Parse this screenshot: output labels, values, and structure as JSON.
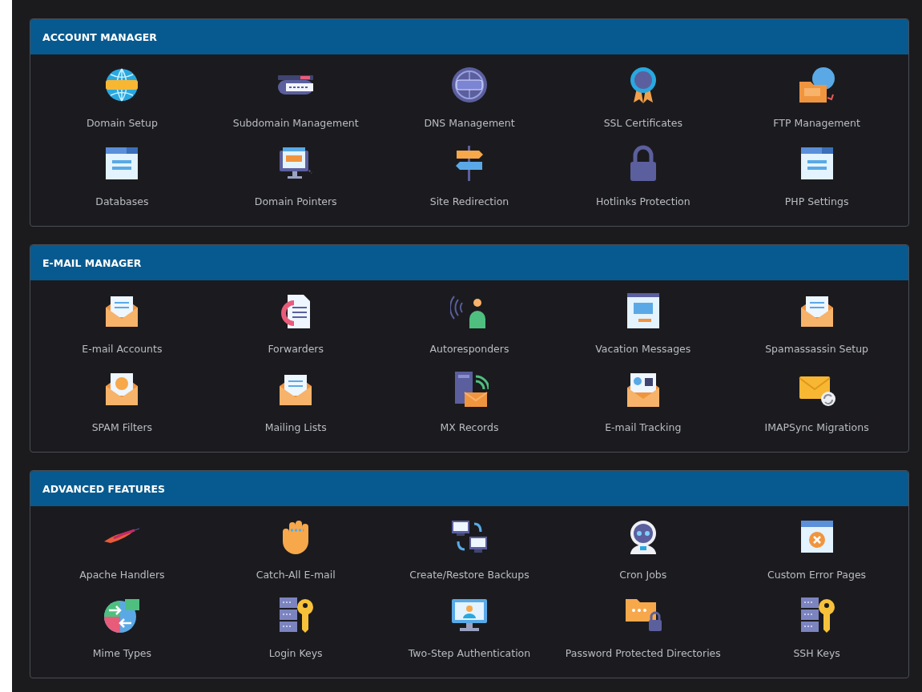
{
  "sections": [
    {
      "title": "ACCOUNT MANAGER",
      "items": [
        "Domain Setup",
        "Subdomain Management",
        "DNS Management",
        "SSL Certificates",
        "FTP Management",
        "Databases",
        "Domain Pointers",
        "Site Redirection",
        "Hotlinks Protection",
        "PHP Settings"
      ]
    },
    {
      "title": "E-MAIL MANAGER",
      "items": [
        "E-mail Accounts",
        "Forwarders",
        "Autoresponders",
        "Vacation Messages",
        "Spamassassin Setup",
        "SPAM Filters",
        "Mailing Lists",
        "MX Records",
        "E-mail Tracking",
        "IMAPSync Migrations"
      ]
    },
    {
      "title": "ADVANCED FEATURES",
      "items": [
        "Apache Handlers",
        "Catch-All E-mail",
        "Create/Restore Backups",
        "Cron Jobs",
        "Custom Error Pages",
        "Mime Types",
        "Login Keys",
        "Two-Step Authentication",
        "Password Protected Directories",
        "SSH Keys"
      ]
    }
  ]
}
